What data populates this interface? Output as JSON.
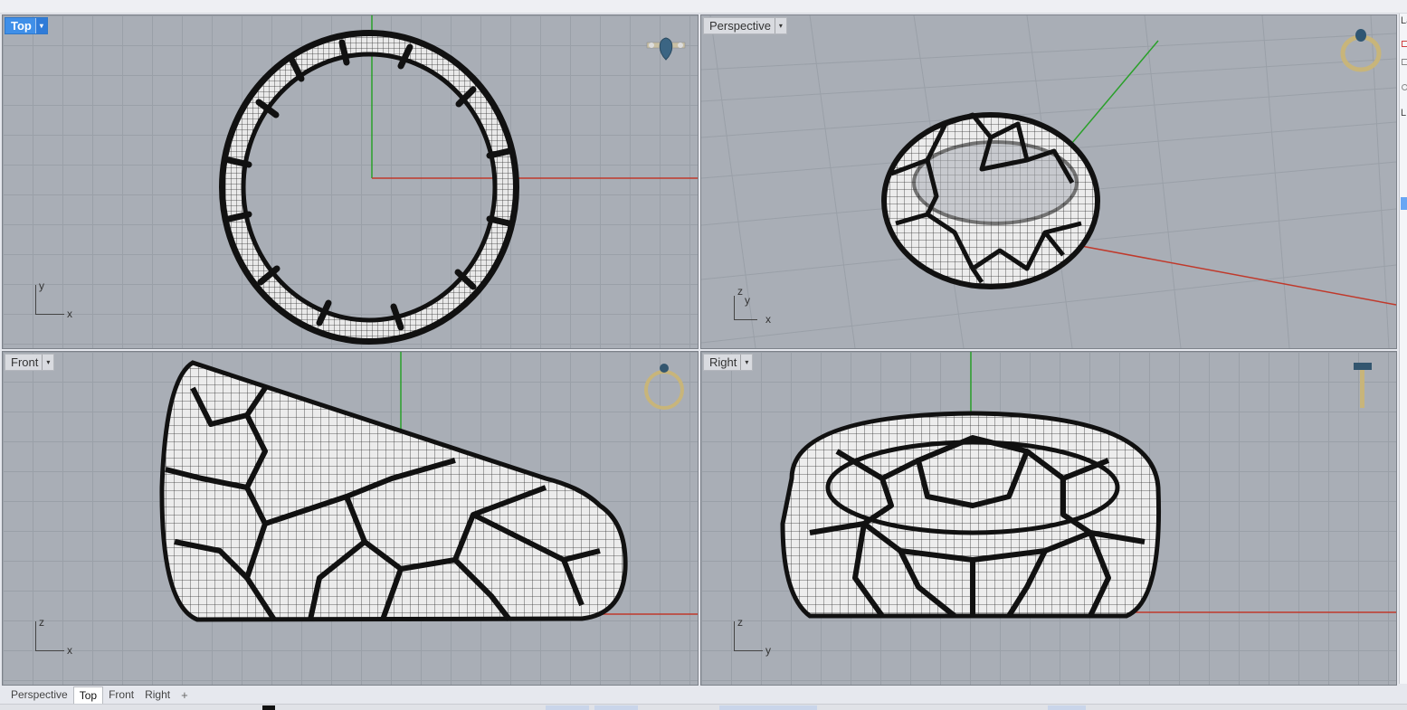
{
  "viewports": [
    {
      "id": "top",
      "label": "Top",
      "active": true,
      "axis": {
        "a": "y",
        "b": "x"
      }
    },
    {
      "id": "perspective",
      "label": "Perspective",
      "active": false,
      "axis": {
        "a": "z",
        "b": "x"
      }
    },
    {
      "id": "front",
      "label": "Front",
      "active": false,
      "axis": {
        "a": "z",
        "b": "x"
      }
    },
    {
      "id": "right",
      "label": "Right",
      "active": false,
      "axis": {
        "a": "z",
        "b": "y"
      }
    }
  ],
  "perspective_axis_extra": "y",
  "tabs": [
    {
      "label": "Perspective",
      "active": false
    },
    {
      "label": "Top",
      "active": true
    },
    {
      "label": "Front",
      "active": false
    },
    {
      "label": "Right",
      "active": false
    }
  ],
  "add_tab_glyph": "+",
  "right_panel": {
    "label_fragment": "La",
    "second_fragment": "L"
  },
  "icons": {
    "dropdown": "▾"
  },
  "colors": {
    "active_label": "#3f8fe8",
    "x_axis": "#c0392b",
    "y_axis": "#2aa02a",
    "grid": "#9aa0a8",
    "background": "#a9aeb6"
  }
}
